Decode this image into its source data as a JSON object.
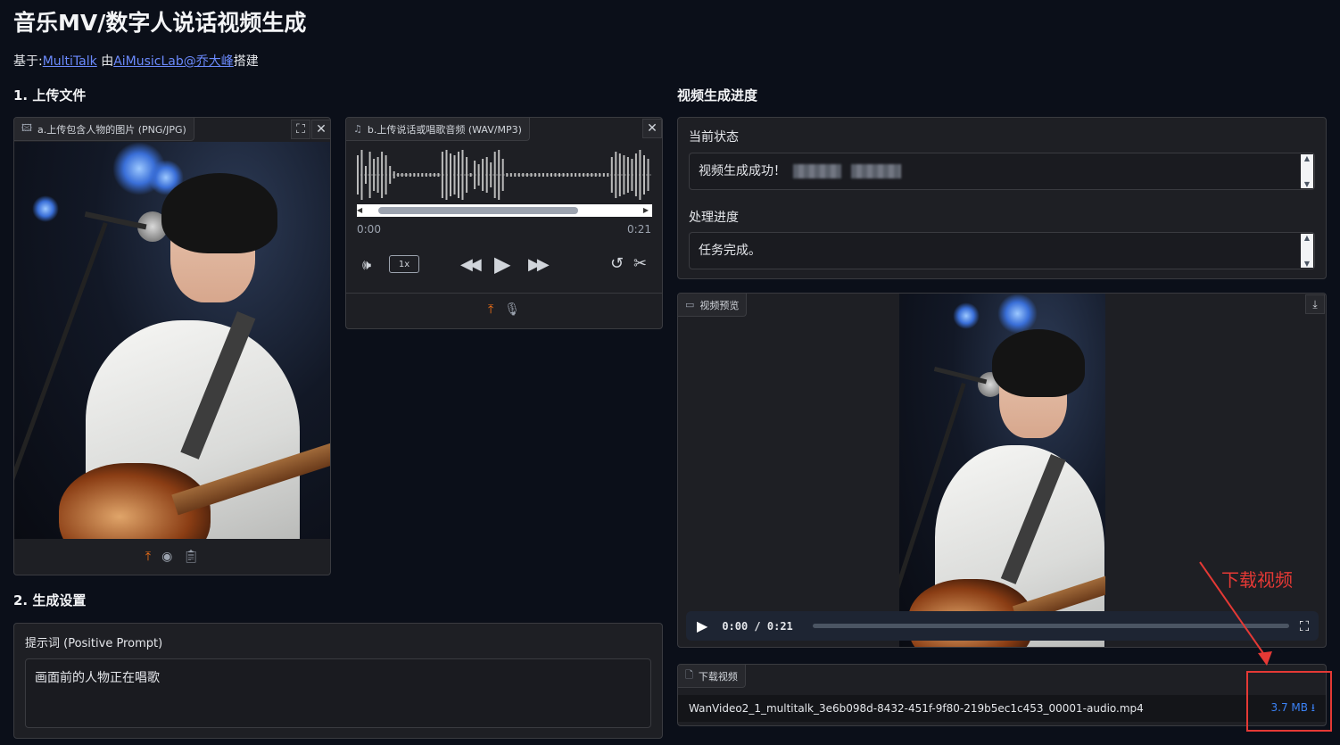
{
  "header": {
    "title": "音乐MV/数字人说话视频生成",
    "subtitle_prefix": "基于:",
    "link_multitalk": "MultiTalk",
    "subtitle_mid": " 由",
    "link_author": "AiMusicLab@乔大峰",
    "subtitle_suffix": "搭建"
  },
  "section1": {
    "title": "1. 上传文件"
  },
  "image_upload": {
    "label": "a.上传包含人物的图片 (PNG/JPG)",
    "icons": [
      "image-icon",
      "fullscreen-icon",
      "close-icon",
      "upload-icon",
      "webcam-icon",
      "clipboard-icon"
    ]
  },
  "audio_upload": {
    "label": "b.上传说话或唱歌音频 (WAV/MP3)",
    "time_current": "0:00",
    "time_total": "0:21",
    "speed": "1x",
    "icons": [
      "music-icon",
      "close-icon",
      "volume-icon",
      "rewind-icon",
      "play-icon",
      "forward-icon",
      "undo-icon",
      "scissors-icon",
      "upload-icon",
      "microphone-icon"
    ]
  },
  "section2": {
    "title": "2. 生成设置"
  },
  "prompt": {
    "label": "提示词 (Positive Prompt)",
    "value": "画面前的人物正在唱歌"
  },
  "progress_section": {
    "title": "视频生成进度"
  },
  "status": {
    "current_label": "当前状态",
    "current_value": "视频生成成功！",
    "process_label": "处理进度",
    "process_value": "任务完成。"
  },
  "video_preview": {
    "label": "视频预览",
    "time": "0:00 / 0:21"
  },
  "download": {
    "label": "下载视频",
    "filename": "WanVideo2_1_multitalk_3e6b098d-8432-451f-9f80-219b5ec1c453_00001-audio.mp4",
    "size": "3.7 MB",
    "annotation": "下载视频"
  },
  "colors": {
    "background": "#0b0f19",
    "accent_orange": "#f97316",
    "link_blue": "#6b8afd",
    "annotation_red": "#e53935"
  }
}
